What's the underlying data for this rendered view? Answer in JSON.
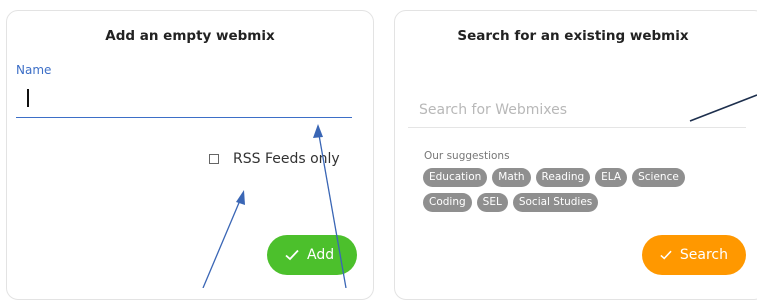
{
  "left_card": {
    "title": "Add an empty webmix",
    "name_label": "Name",
    "name_value": "",
    "rss_label": "RSS Feeds only",
    "rss_checked": false,
    "add_label": "Add",
    "add_color": "#4cc02c"
  },
  "right_card": {
    "title": "Search for an existing webmix",
    "search_placeholder": "Search for Webmixes",
    "suggestions_title": "Our suggestions",
    "suggestions": [
      "Education",
      "Math",
      "Reading",
      "ELA",
      "Science",
      "Coding",
      "SEL",
      "Social Studies"
    ],
    "search_label": "Search",
    "search_color": "#ff9800"
  },
  "colors": {
    "accent_blue": "#3d6fc7",
    "chip_gray": "#8f8f8f",
    "annotation_blue": "#3a66b5",
    "annotation_navy": "#1d2f4d"
  },
  "icons": {
    "button_icon": "check-icon"
  }
}
